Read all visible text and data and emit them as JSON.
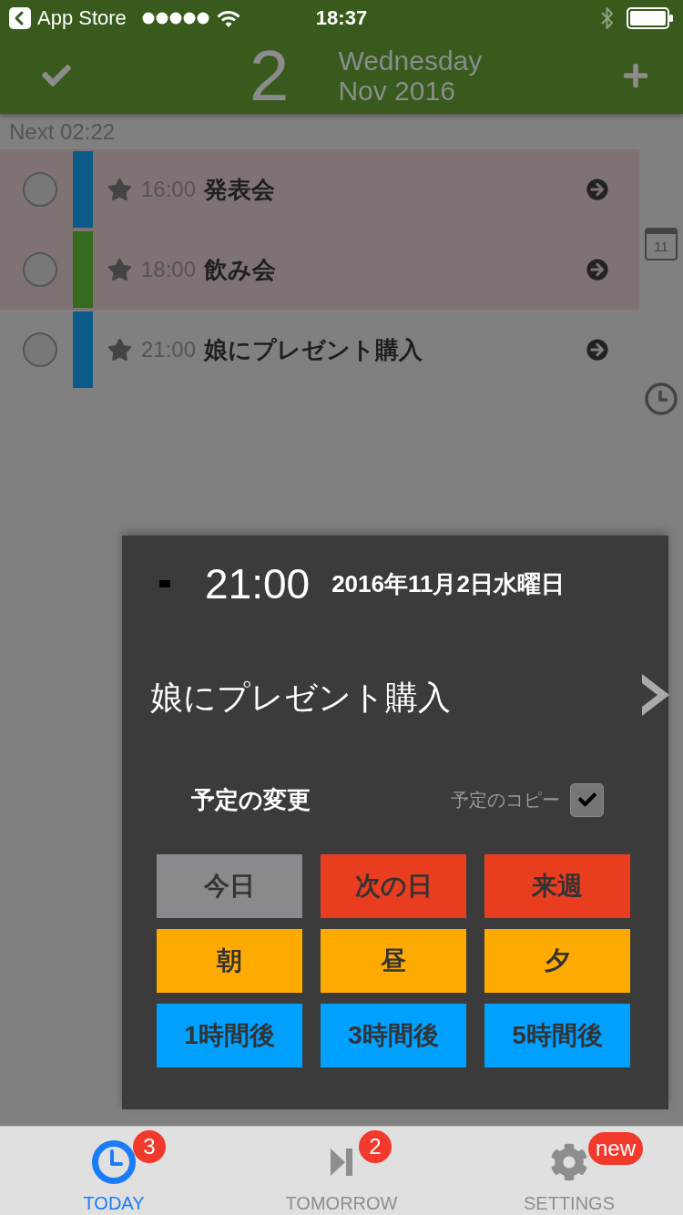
{
  "status_bar": {
    "back_label": "App Store",
    "time": "18:37"
  },
  "header": {
    "day": "2",
    "weekday": "Wednesday",
    "month_year": "Nov 2016"
  },
  "next_label": "Next 02:22",
  "events": [
    {
      "time": "16:00",
      "title": "発表会",
      "color": "#0b5b89",
      "highlighted": true,
      "done": false,
      "starred": true
    },
    {
      "time": "18:00",
      "title": "飲み会",
      "color": "#356a1f",
      "highlighted": true,
      "done": false,
      "starred": true
    },
    {
      "time": "21:00",
      "title": "娘にプレゼント購入",
      "color": "#0b5b89",
      "highlighted": false,
      "done": false,
      "starred": true
    }
  ],
  "sidebar": {
    "calendar_day": "11"
  },
  "popup": {
    "time": "21:00",
    "date": "2016年11月2日水曜日",
    "title": "娘にプレゼント購入",
    "change_label": "予定の変更",
    "copy_label": "予定のコピー",
    "copy_checked": true,
    "buttons": [
      {
        "label": "今日",
        "color": "#8a898e"
      },
      {
        "label": "次の日",
        "color": "#e83e1f"
      },
      {
        "label": "来週",
        "color": "#e83e1f"
      },
      {
        "label": "朝",
        "color": "#ffaa00"
      },
      {
        "label": "昼",
        "color": "#ffaa00"
      },
      {
        "label": "夕",
        "color": "#ffaa00"
      },
      {
        "label": "1時間後",
        "color": "#00a0ff"
      },
      {
        "label": "3時間後",
        "color": "#00a0ff"
      },
      {
        "label": "5時間後",
        "color": "#00a0ff"
      }
    ]
  },
  "tabs": [
    {
      "label": "TODAY",
      "badge": "3",
      "selected": true
    },
    {
      "label": "TOMORROW",
      "badge": "2",
      "selected": false
    },
    {
      "label": "SETTINGS",
      "badge": "new",
      "selected": false
    }
  ]
}
